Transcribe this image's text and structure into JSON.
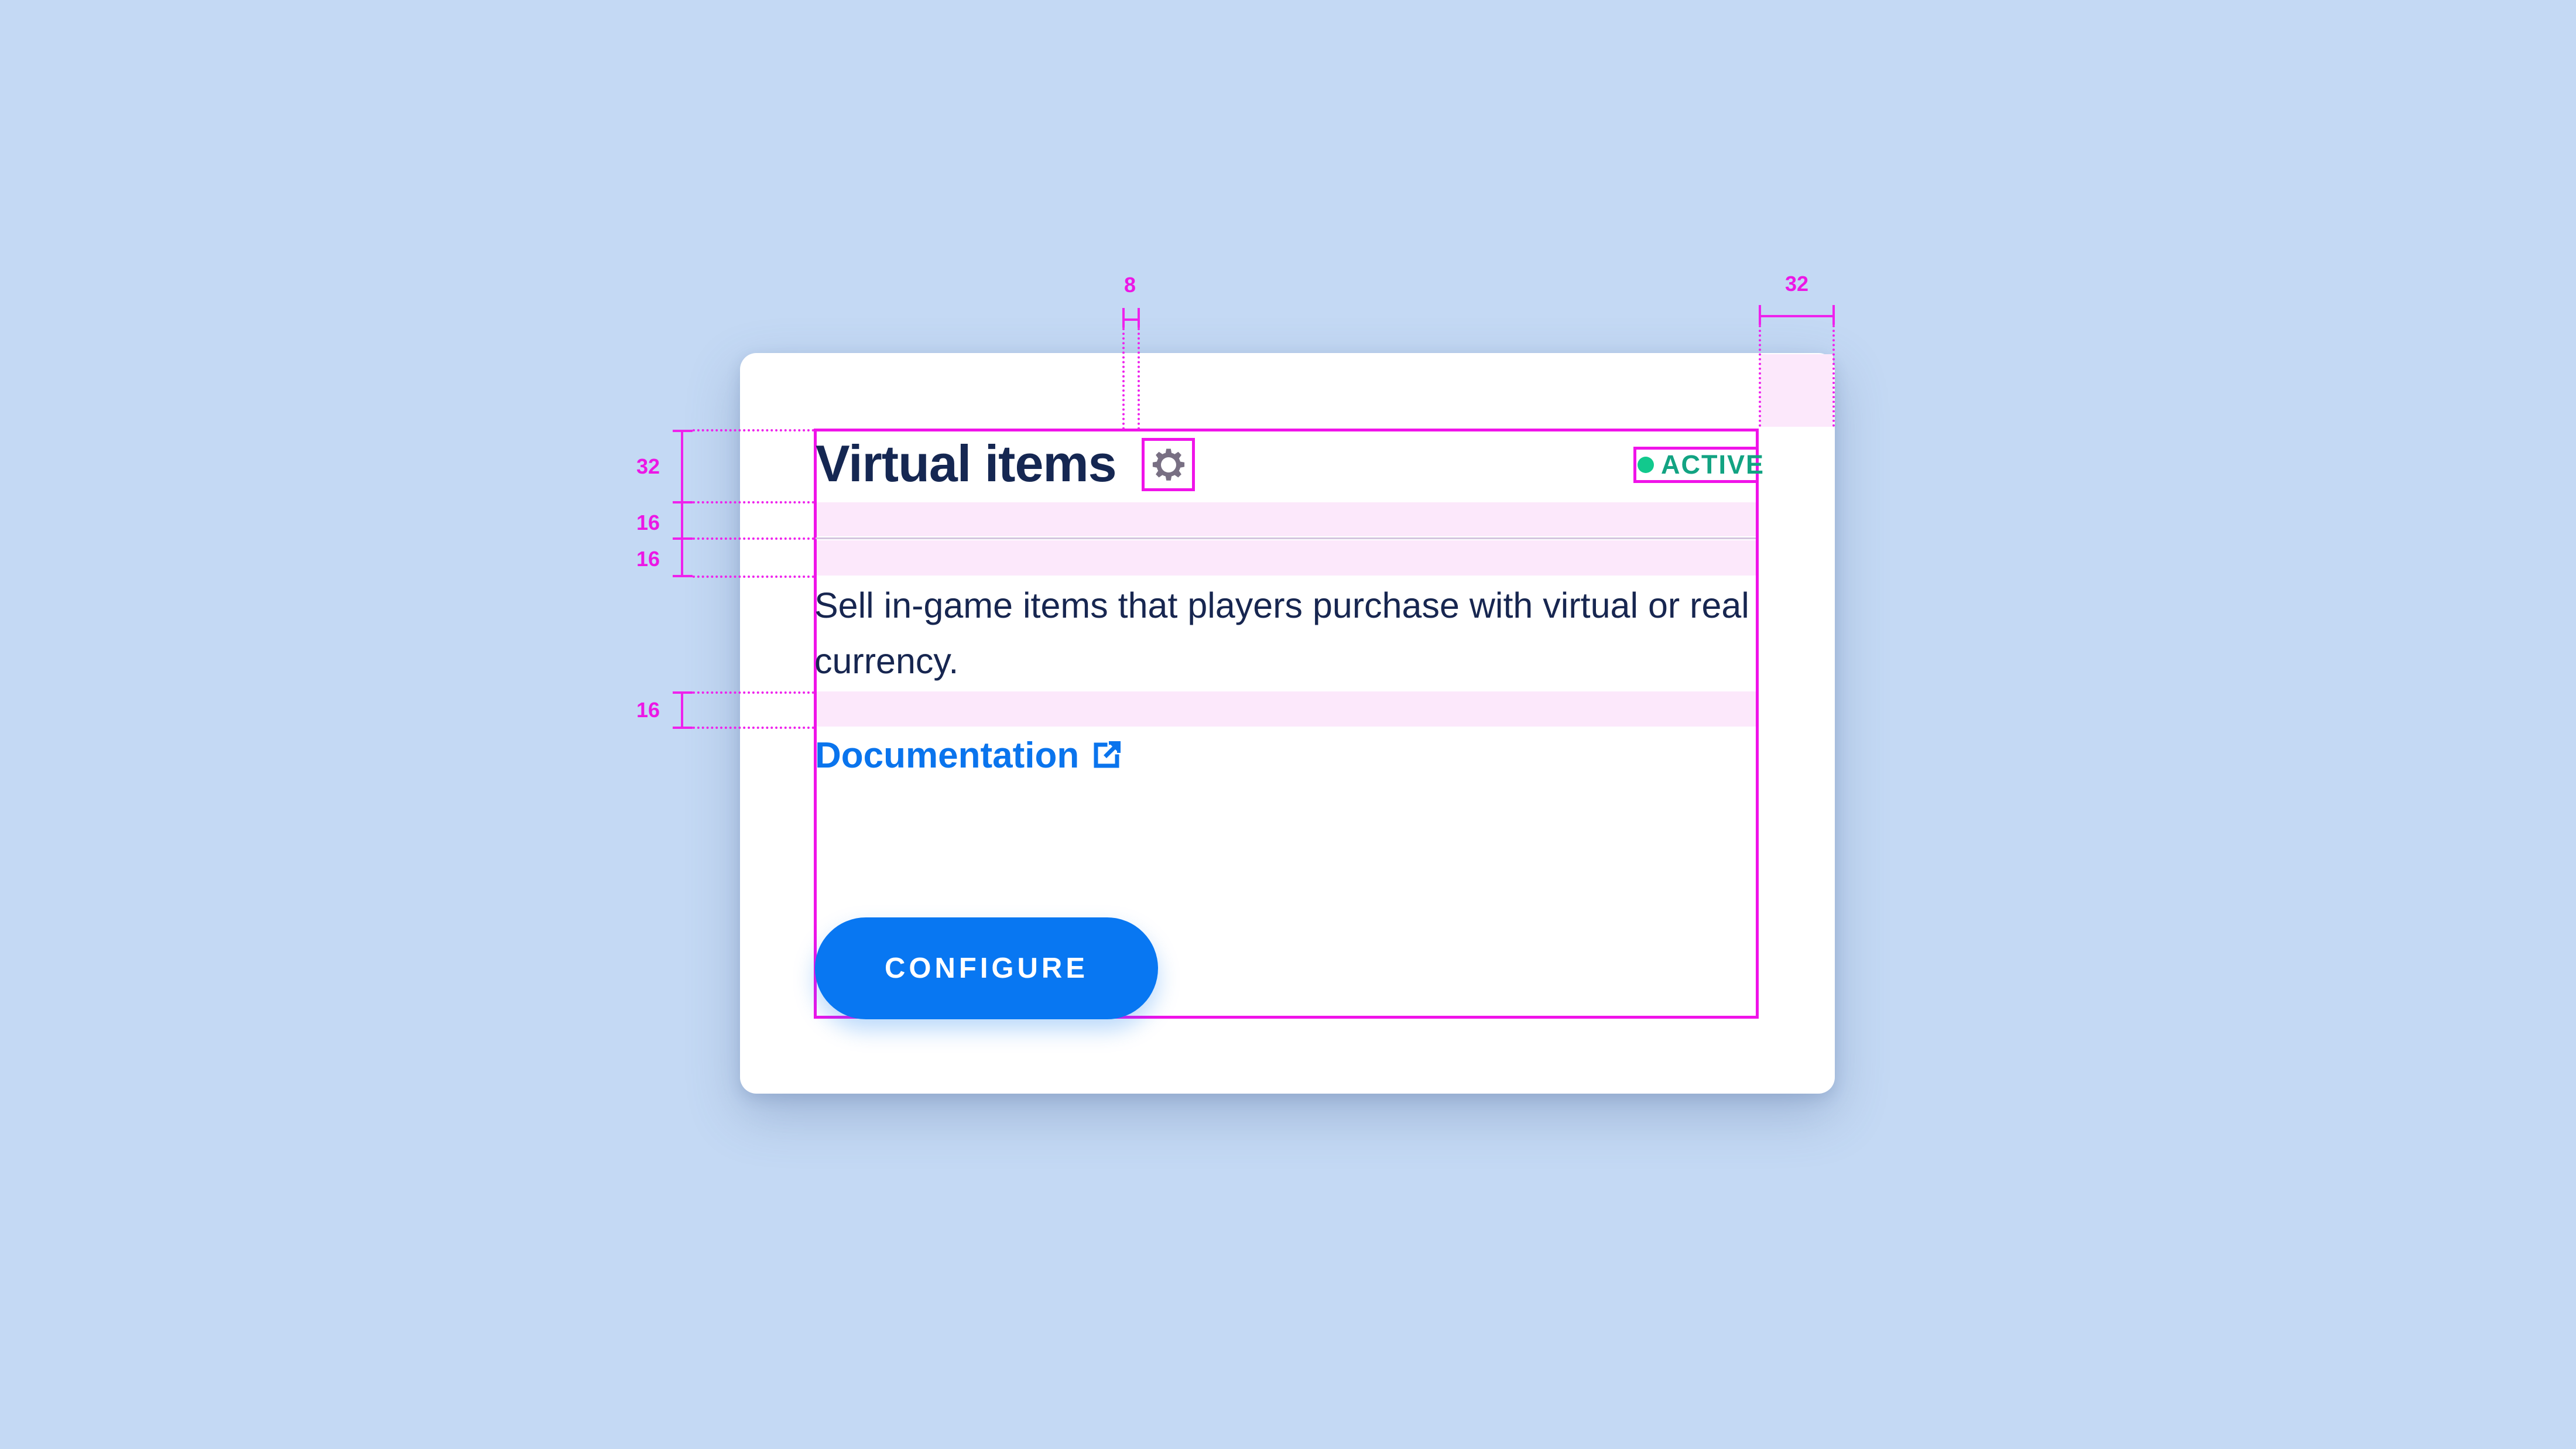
{
  "colors": {
    "background": "#c4d9f4",
    "card": "#ffffff",
    "accent": "#0877f2",
    "status": "#12c98d",
    "annotation": "#ee22ec",
    "title": "#152752"
  },
  "card": {
    "title": "Virtual items",
    "settings_icon": "gear-icon",
    "status_label": "ACTIVE",
    "description": "Sell in-game items that players purchase with virtual or real currency.",
    "documentation_label": "Documentation",
    "external_icon": "external-link-icon",
    "configure_label": "CONFIGURE"
  },
  "measurements": {
    "gear_spacing": "8",
    "right_padding": "32",
    "title_height": "32",
    "gap_above_divider": "16",
    "gap_below_divider": "16",
    "gap_above_link": "16"
  }
}
